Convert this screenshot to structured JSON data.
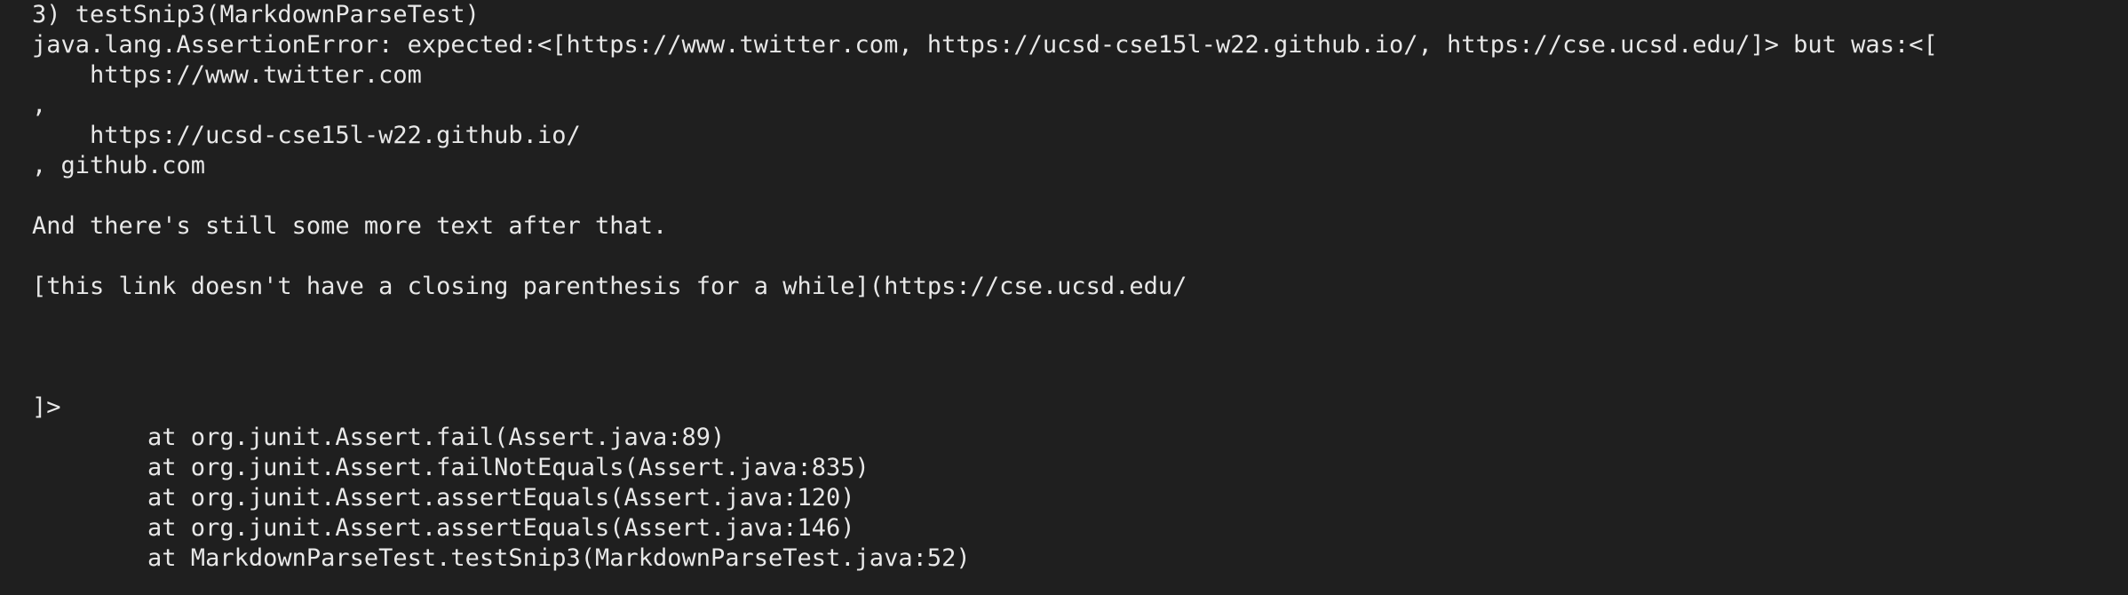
{
  "terminal": {
    "background": "#1f1f1f",
    "foreground": "#e8e8e8",
    "lines": [
      "3) testSnip3(MarkdownParseTest)",
      "java.lang.AssertionError: expected:<[https://www.twitter.com, https://ucsd-cse15l-w22.github.io/, https://cse.ucsd.edu/]> but was:<[",
      "    https://www.twitter.com",
      ",",
      "    https://ucsd-cse15l-w22.github.io/",
      ", github.com",
      "",
      "And there's still some more text after that.",
      "",
      "[this link doesn't have a closing parenthesis for a while](https://cse.ucsd.edu/",
      "",
      "",
      "",
      "]>",
      "        at org.junit.Assert.fail(Assert.java:89)",
      "        at org.junit.Assert.failNotEquals(Assert.java:835)",
      "        at org.junit.Assert.assertEquals(Assert.java:120)",
      "        at org.junit.Assert.assertEquals(Assert.java:146)",
      "        at MarkdownParseTest.testSnip3(MarkdownParseTest.java:52)"
    ]
  }
}
